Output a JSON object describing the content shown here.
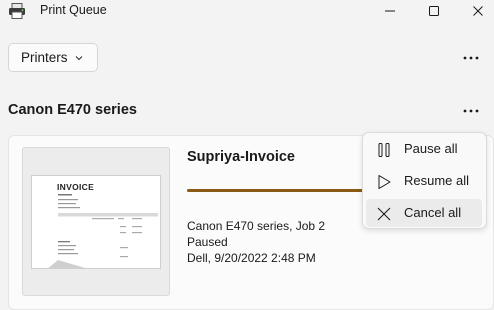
{
  "window": {
    "title": "Print Queue",
    "app_icon": "printer-icon",
    "controls": [
      "minimize-icon",
      "maximize-icon",
      "close-icon"
    ]
  },
  "toolbar": {
    "printers_label": "Printers",
    "printers_icon": "chevron-down-icon",
    "more_icon": "more-horizontal-icon"
  },
  "printer": {
    "name": "Canon E470 series",
    "more_icon": "more-horizontal-icon"
  },
  "job": {
    "document_name": "Supriya-Invoice",
    "thumbnail_title": "INVOICE",
    "details": [
      "Canon E470 series, Job 2",
      "Paused",
      "Dell, 9/20/2022 2:48 PM"
    ],
    "progress_color": "#8a5a14"
  },
  "context_menu": {
    "items": [
      {
        "label": "Pause all",
        "icon": "pause-icon"
      },
      {
        "label": "Resume all",
        "icon": "play-icon"
      },
      {
        "label": "Cancel all",
        "icon": "close-icon"
      }
    ],
    "highlighted": "Cancel all"
  }
}
